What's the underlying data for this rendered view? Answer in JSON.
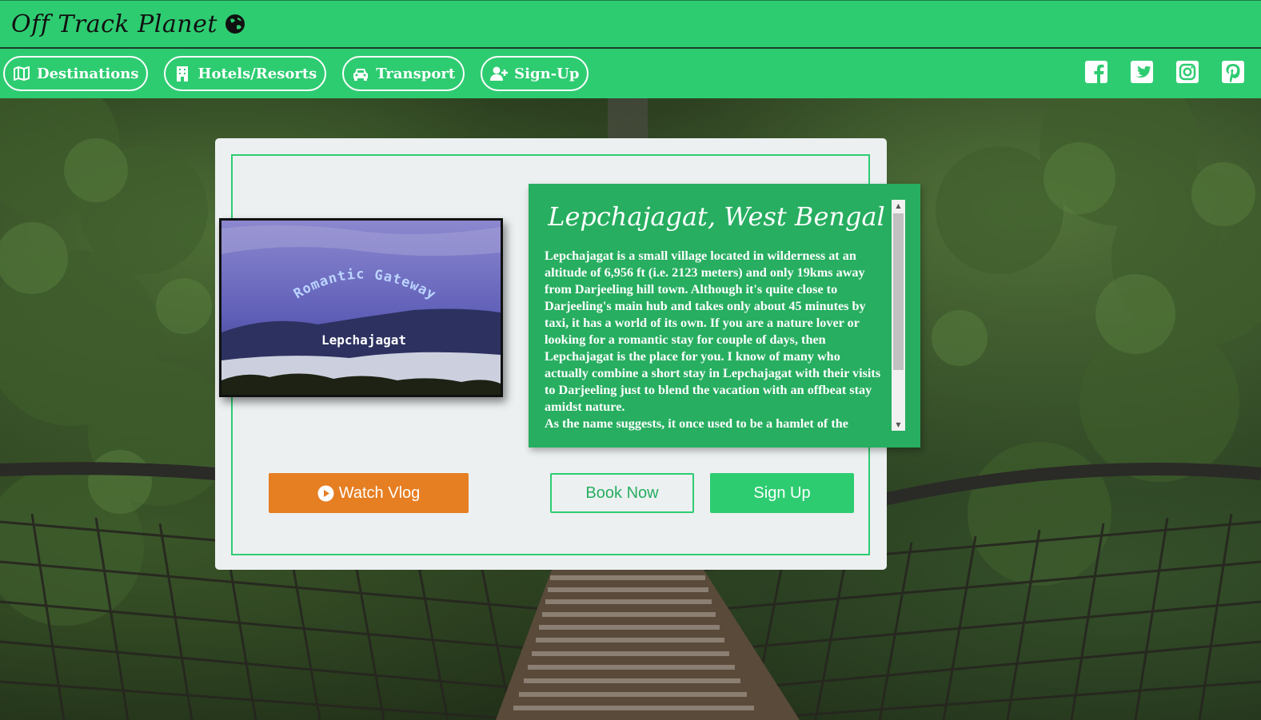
{
  "header": {
    "brand": "Off Track Planet"
  },
  "nav": {
    "items": [
      {
        "label": "Destinations",
        "icon": "map-icon"
      },
      {
        "label": "Hotels/Resorts",
        "icon": "building-icon"
      },
      {
        "label": "Transport",
        "icon": "car-icon"
      },
      {
        "label": "Sign-Up",
        "icon": "user-plus-icon"
      }
    ],
    "social": [
      "facebook-icon",
      "twitter-icon",
      "instagram-icon",
      "pinterest-icon"
    ]
  },
  "destination": {
    "image_caption_arc": "Romantic Gateway",
    "image_caption": "Lepchajagat",
    "title": "Lepchajagat, West Bengal",
    "description": "Lepchajagat is a small village located in wilderness at an altitude of 6,956 ft (i.e. 2123 meters) and only 19kms away from Darjeeling hill town. Although it's quite close to Darjeeling's main hub and takes only about 45 minutes by taxi, it has a world of its own. If you are a nature lover or looking for a romantic stay for couple of days, then Lepchajagat is the place for you. I know of many who actually combine a short stay in Lepchajagat with their visits to Darjeeling just to blend the vacation with an offbeat stay amidst nature.",
    "description_2": "As the name suggests, it once used to be a hamlet of the"
  },
  "actions": {
    "watch_vlog": "Watch Vlog",
    "book_now": "Book Now",
    "sign_up": "Sign Up"
  },
  "colors": {
    "brand_green": "#2ecc71",
    "dark_green": "#27ae60",
    "orange": "#e67e22",
    "card_bg": "#ecf0f1"
  }
}
